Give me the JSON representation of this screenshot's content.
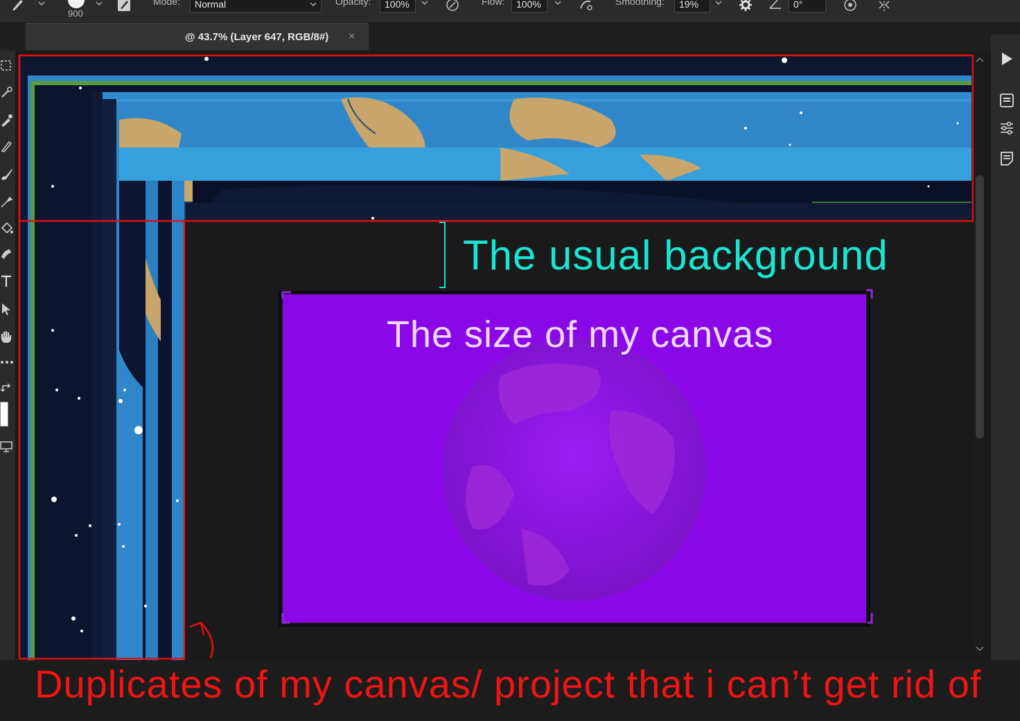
{
  "options_bar": {
    "brush_size": "900",
    "mode_label": "Mode:",
    "mode_value": "Normal",
    "opacity_label": "Opacity:",
    "opacity_value": "100%",
    "flow_label": "Flow:",
    "flow_value": "100%",
    "smoothing_label": "Smoothing:",
    "smoothing_value": "19%",
    "angle_value": "0°"
  },
  "document_tab": {
    "title": "@ 43.7% (Layer 647, RGB/8#)",
    "close": "×"
  },
  "annotations": {
    "usual_background": "The usual background",
    "canvas_size": "The size of my canvas",
    "duplicates": "Duplicates of my canvas/ project that i can’t get rid of"
  },
  "colors": {
    "accent_red": "#e01010",
    "accent_cyan": "#19e6d2",
    "canvas_purple": "#8a08e8",
    "bracket_purple": "#8a2bd0"
  },
  "icons": {
    "left_toolbar": [
      "marquee-icon",
      "quick-select-icon",
      "eyedropper-icon",
      "healing-icon",
      "brush-icon",
      "clone-stamp-icon",
      "paint-bucket-icon",
      "smudge-icon",
      "type-icon",
      "path-select-icon",
      "hand-icon",
      "more-icon",
      "swap-colors-icon",
      "foreground-color-icon",
      "screen-mode-icon"
    ],
    "right_strip": [
      "play-icon",
      "properties-icon",
      "adjustments-icon",
      "notes-icon"
    ]
  }
}
